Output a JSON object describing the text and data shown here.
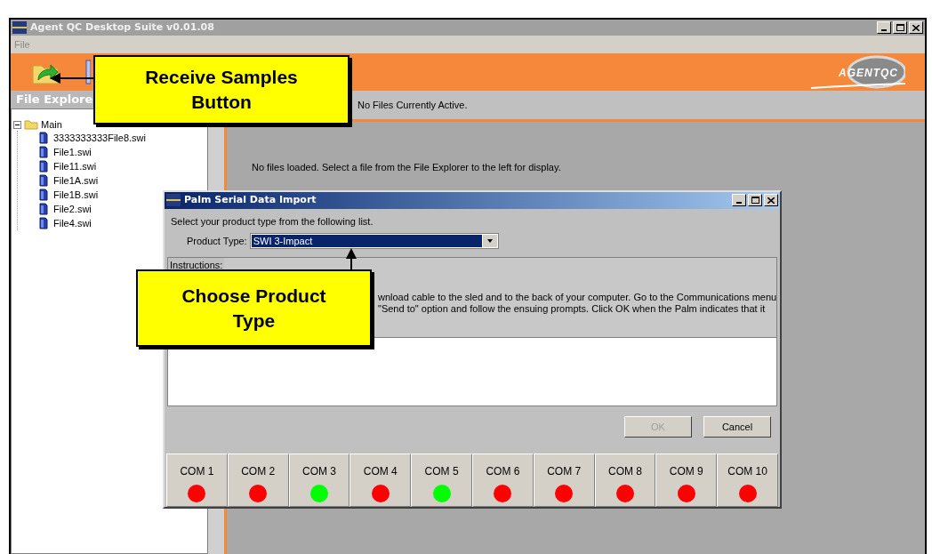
{
  "window": {
    "title": "Agent QC Desktop Suite v0.01.08"
  },
  "menu": [
    "File"
  ],
  "logo": "AGENTQC",
  "file_explorer": {
    "title": "File Explore",
    "tree": {
      "label": "Main",
      "expanded": true,
      "children": [
        {
          "label": "3333333333File8.swi"
        },
        {
          "label": "File1.swi"
        },
        {
          "label": "File11.swi"
        },
        {
          "label": "File1A.swi"
        },
        {
          "label": "File1B.swi"
        },
        {
          "label": "File2.swi"
        },
        {
          "label": "File4.swi"
        }
      ]
    }
  },
  "status": "No Files Currently Active.",
  "empty_message": "No files loaded. Select a file from the File Explorer to the left for display.",
  "dialog": {
    "title": "Palm Serial Data Import",
    "prompt": "Select your product type from the following list.",
    "product_type_label": "Product Type:",
    "product_type_value": "SWI 3-Impact",
    "instructions_title": "Instructions:",
    "instructions_lines": [
      "wnload cable to the sled and to the back of your computer. Go to the Communications menu",
      "\"Send to\" option and follow the ensuing prompts. Click OK when the Palm indicates that it"
    ],
    "buttons": [
      {
        "label": "OK",
        "disabled": true
      },
      {
        "label": "Cancel",
        "disabled": false
      }
    ],
    "ports": [
      {
        "name": "COM 1",
        "color": "#ff0000"
      },
      {
        "name": "COM 2",
        "color": "#ff0000"
      },
      {
        "name": "COM 3",
        "color": "#00ff00"
      },
      {
        "name": "COM 4",
        "color": "#ff0000"
      },
      {
        "name": "COM 5",
        "color": "#00ff00"
      },
      {
        "name": "COM 6",
        "color": "#ff0000"
      },
      {
        "name": "COM 7",
        "color": "#ff0000"
      },
      {
        "name": "COM 8",
        "color": "#ff0000"
      },
      {
        "name": "COM 9",
        "color": "#ff0000"
      },
      {
        "name": "COM 10",
        "color": "#ff0000"
      }
    ]
  },
  "callouts": [
    {
      "text": "Receive Samples Button"
    },
    {
      "text": "Choose Product Type"
    }
  ]
}
